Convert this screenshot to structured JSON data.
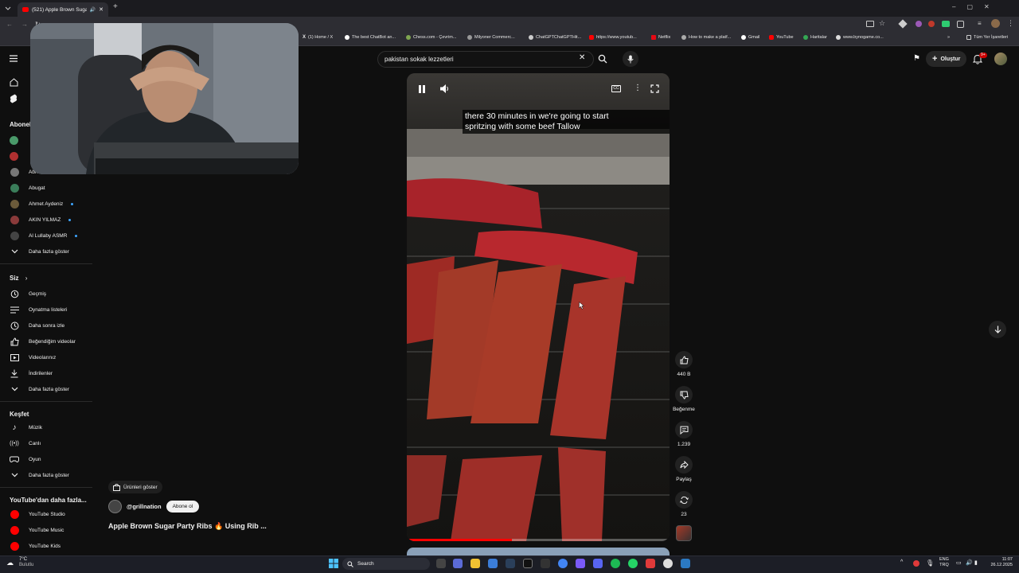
{
  "browser": {
    "active_tab_title": "(521) Apple Brown Sugar P",
    "new_tab_symbol": "+",
    "bookmarks": [
      "(1) Home / X",
      "The best ChatBot an...",
      "Chess.com - Çevrim...",
      "Milyoner Commerc...",
      "ChatGPTChatGPTHit...",
      "https://www.youtub...",
      "Netflix",
      "How to make a platf...",
      "Gmail",
      "YouTube",
      "Haritalar",
      "www.bynogame.co..."
    ],
    "all_bookmarks_label": "Tüm Yer İşaretleri"
  },
  "header": {
    "search_value": "pakistan sokak lezzetleri",
    "create_label": "Oluştur",
    "notification_count": "9+"
  },
  "sidebar": {
    "subscriptions_heading": "Abonel",
    "subscriptions": [
      {
        "label": "Abnomal...",
        "color": "#777777",
        "dot": false
      },
      {
        "label": "Abugat",
        "color": "#3a7d5a",
        "dot": false
      },
      {
        "label": "Ahmet Aydeniz",
        "color": "#6b5a3a",
        "dot": true
      },
      {
        "label": "AKIN YILMAZ",
        "color": "#8a3a3a",
        "dot": true
      },
      {
        "label": "Al Lullaby ASMR",
        "color": "#444444",
        "dot": true
      }
    ],
    "show_more_1": "Daha fazla göster",
    "you_heading": "Siz",
    "you_items": [
      {
        "label": "Geçmiş",
        "icon": "history-icon"
      },
      {
        "label": "Oynatma listeleri",
        "icon": "playlists-icon"
      },
      {
        "label": "Daha sonra izle",
        "icon": "clock-icon"
      },
      {
        "label": "Beğendiğim videolar",
        "icon": "thumbs-up-icon"
      },
      {
        "label": "Videolarınız",
        "icon": "your-videos-icon"
      },
      {
        "label": "İndirilenler",
        "icon": "download-icon"
      }
    ],
    "show_more_2": "Daha fazla göster",
    "explore_heading": "Keşfet",
    "explore_items": [
      {
        "label": "Müzik",
        "icon": "music-icon"
      },
      {
        "label": "Canlı",
        "icon": "live-icon"
      },
      {
        "label": "Oyun",
        "icon": "gaming-icon"
      }
    ],
    "show_more_3": "Daha fazla göster",
    "more_yt_heading": "YouTube'dan daha fazla...",
    "more_yt_items": [
      "YouTube Studio",
      "YouTube Music",
      "YouTube Kids"
    ]
  },
  "video": {
    "caption_line1": "there 30 minutes in we're going to start",
    "caption_line2": "spritzing with some beef Tallow",
    "products_label": "Ürünleri göster",
    "channel_handle": "@grillnation",
    "subscribe_label": "Abone ol",
    "title": "Apple Brown Sugar Party Ribs 🔥 Using Rib ..."
  },
  "actions": {
    "like_count": "440 B",
    "dislike_label": "Beğenme",
    "comments_count": "1.239",
    "share_label": "Paylaş",
    "remix_count": "23"
  },
  "taskbar": {
    "weather_temp": "7°C",
    "weather_desc": "Bulutlu",
    "search_label": "Search",
    "lang_line1": "ENG",
    "lang_line2": "TRQ",
    "time": "11:07",
    "date": "26.12.2025"
  },
  "colors": {
    "accent_red": "#ff0000",
    "link_blue": "#3ea6ff",
    "background": "#0f0f0f"
  }
}
